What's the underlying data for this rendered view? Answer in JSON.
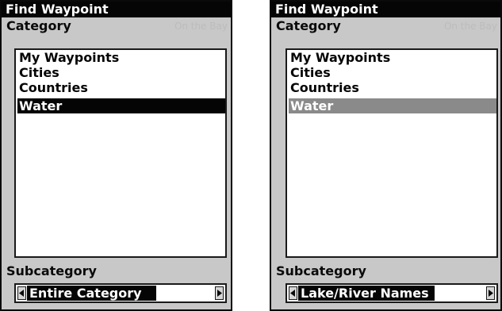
{
  "screens": [
    {
      "title": "Find Waypoint",
      "category_label": "Category",
      "ghost_text": "On the Bay",
      "categories": [
        "My Waypoints",
        "Cities",
        "Countries",
        "Water"
      ],
      "selected_category": "Water",
      "subcategory_label": "Subcategory",
      "subcategory_value": "Entire Category"
    },
    {
      "title": "Find Waypoint",
      "category_label": "Category",
      "ghost_text": "On the Bay",
      "categories": [
        "My Waypoints",
        "Cities",
        "Countries",
        "Water"
      ],
      "selected_category": "Water",
      "subcategory_label": "Subcategory",
      "subcategory_value": "Lake/River Names"
    }
  ],
  "icons": {
    "left_arrow": "arrow-left-icon",
    "right_arrow": "arrow-right-icon"
  },
  "colors": {
    "screen_bg": "#c8c8c8",
    "highlight_active": "#050505",
    "highlight_inactive": "#8a8a8a"
  }
}
